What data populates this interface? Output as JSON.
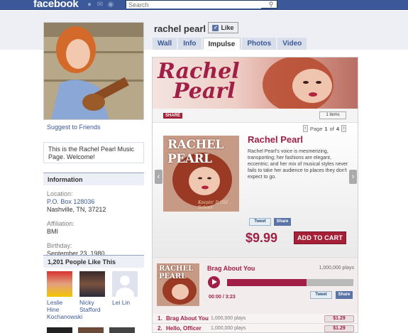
{
  "topbar": {
    "logo": "facebook",
    "search_placeholder": "Search"
  },
  "page": {
    "name": "rachel pearl",
    "like_label": "Like"
  },
  "tabs": [
    {
      "label": "Wall"
    },
    {
      "label": "Info"
    },
    {
      "label": "Impulse"
    },
    {
      "label": "Photos"
    },
    {
      "label": "Video"
    }
  ],
  "sidebar": {
    "suggest_link": "Suggest to Friends",
    "intro_text": "This is the Rachel Pearl Music Page. Welcome!",
    "info_title": "Information",
    "location_label": "Location:",
    "location_line1": "P.O. Box 128036",
    "location_line2": "Nashville, TN, 37212",
    "affiliation_label": "Affiliation:",
    "affiliation_value": "BMI",
    "birthday_label": "Birthday:",
    "birthday_value": "September 23, 1980",
    "likes_title": "1,201 People Like This",
    "friends": [
      {
        "name": "Leslie Hine Kochanowski"
      },
      {
        "name": "Nicky Stafford"
      },
      {
        "name": "Lei Lin"
      }
    ]
  },
  "store": {
    "banner_text_line1": "Rachel",
    "banner_text_line2": "Pearl",
    "share_label": "SHARE",
    "items_label": "1 items",
    "pager_text_pre": "Page",
    "pager_current": "1",
    "pager_text_mid": "of",
    "pager_total": "4",
    "album_title": "RACHEL PEARL",
    "album_subtitle": "Keepin' It Old School",
    "product_title": "Rachel Pearl",
    "product_desc": "Rachel Pearl's voice is mesmerizing, transporting; her fashions are elegant, eccentric; and her mix of musical styles never fails to take her audience to places they don't expect to go.",
    "tweet_label": "Tweet",
    "share_fb_label": "Share",
    "price": "$9.99",
    "add_to_cart": "ADD TO CART"
  },
  "player": {
    "thumb_title": "RACHEL PEARL",
    "track_name": "Brag About You",
    "plays": "1,000,000 plays",
    "time": "00:00 / 3:23",
    "progress_fraction": 0.63,
    "tweet_label": "Tweet",
    "share_label": "Share"
  },
  "tracks": [
    {
      "num": "1.",
      "name": "Brag About You",
      "plays": "1,000,000 plays",
      "price": "$1.29"
    },
    {
      "num": "2.",
      "name": "Hello, Officer",
      "plays": "1,000,000 plays",
      "price": "$1.29"
    }
  ],
  "colors": {
    "facebook_blue": "#3b5998",
    "brand_red": "#a11f46",
    "cart_red": "#a52036"
  }
}
